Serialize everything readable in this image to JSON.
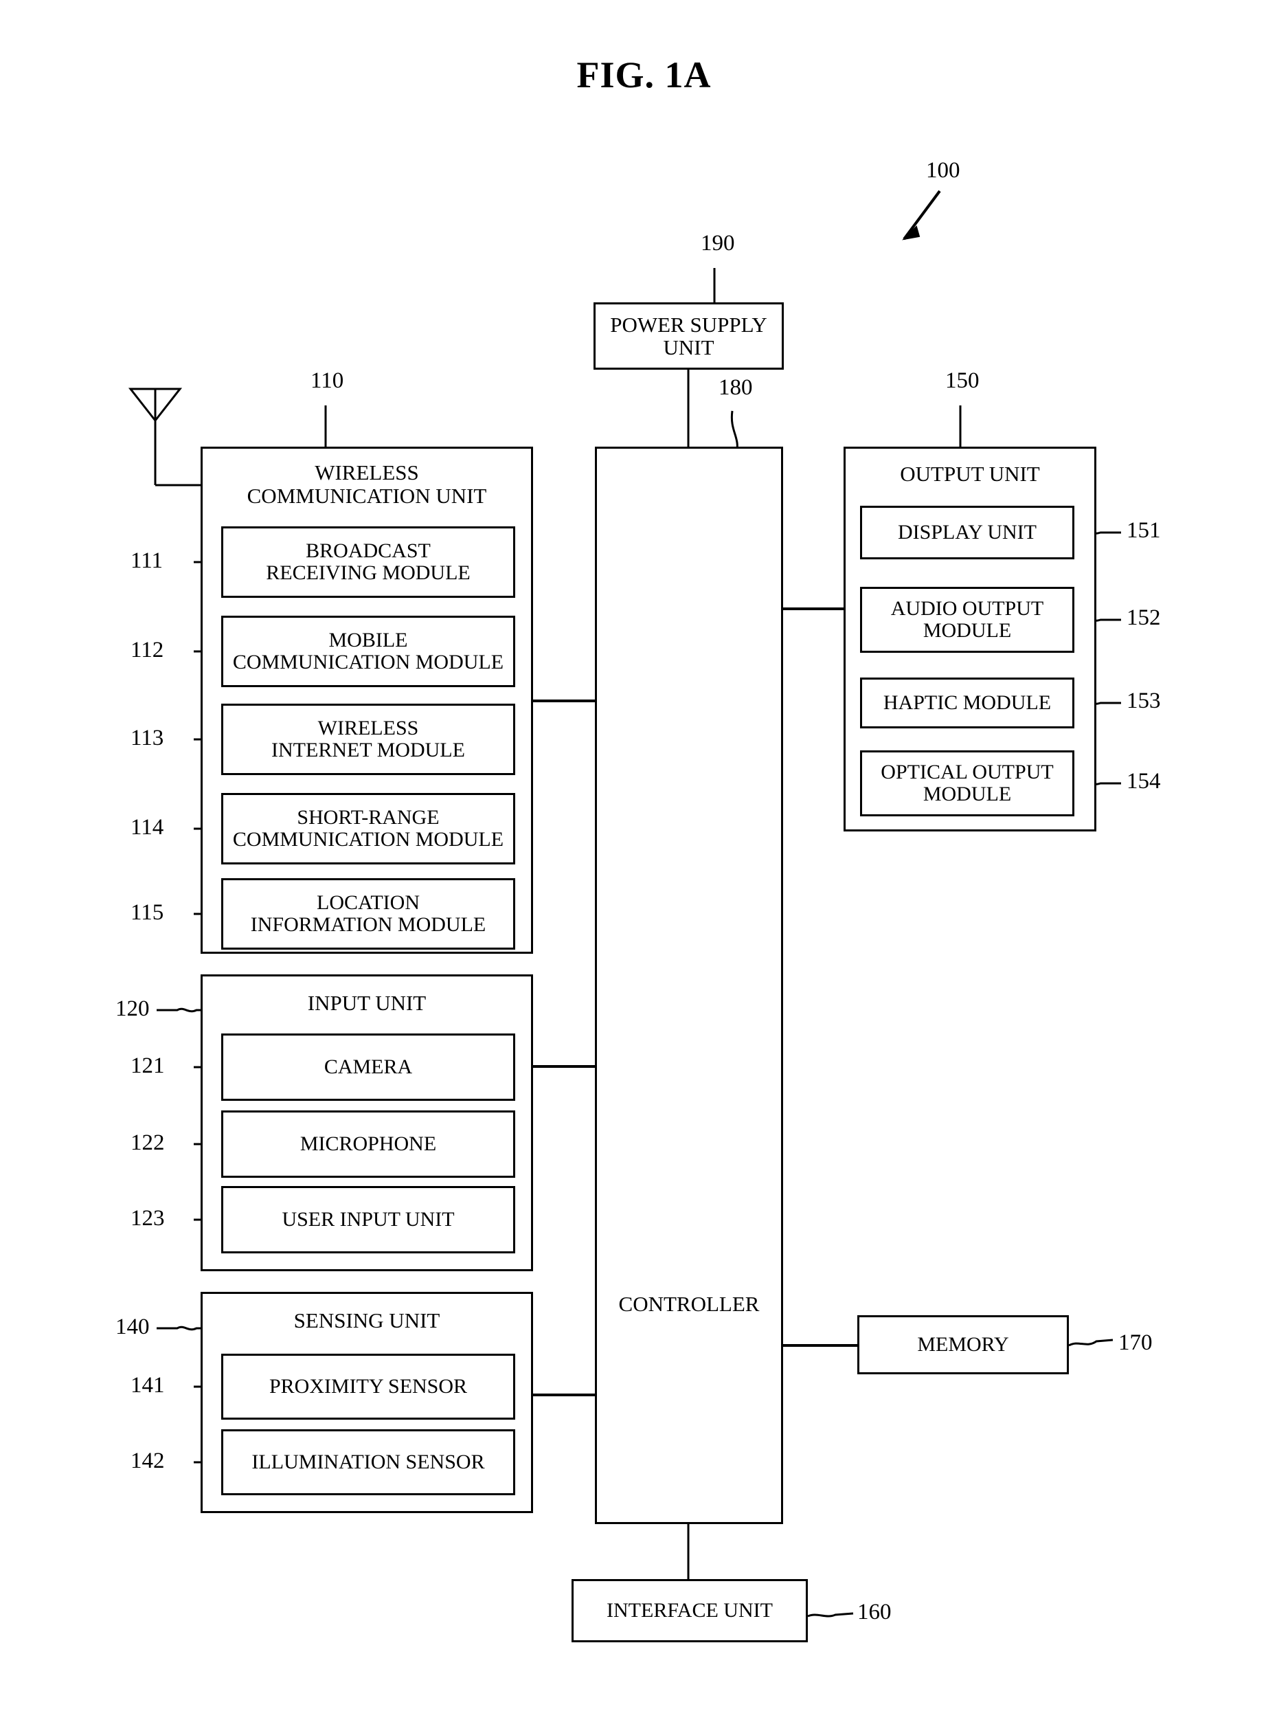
{
  "figure": {
    "title": "FIG. 1A",
    "device_ref": "100"
  },
  "power_supply": {
    "ref": "190",
    "label_line1": "POWER SUPPLY",
    "label_line2": "UNIT"
  },
  "controller": {
    "ref": "180",
    "label": "CONTROLLER"
  },
  "wireless_communication_unit": {
    "ref": "110",
    "title_line1": "WIRELESS",
    "title_line2": "COMMUNICATION UNIT",
    "modules": [
      {
        "ref": "111",
        "line1": "BROADCAST",
        "line2": "RECEIVING MODULE"
      },
      {
        "ref": "112",
        "line1": "MOBILE",
        "line2": "COMMUNICATION MODULE"
      },
      {
        "ref": "113",
        "line1": "WIRELESS",
        "line2": "INTERNET MODULE"
      },
      {
        "ref": "114",
        "line1": "SHORT-RANGE",
        "line2": "COMMUNICATION MODULE"
      },
      {
        "ref": "115",
        "line1": "LOCATION",
        "line2": "INFORMATION MODULE"
      }
    ]
  },
  "input_unit": {
    "ref": "120",
    "title": "INPUT UNIT",
    "modules": [
      {
        "ref": "121",
        "label": "CAMERA"
      },
      {
        "ref": "122",
        "label": "MICROPHONE"
      },
      {
        "ref": "123",
        "label": "USER INPUT UNIT"
      }
    ]
  },
  "sensing_unit": {
    "ref": "140",
    "title": "SENSING UNIT",
    "modules": [
      {
        "ref": "141",
        "label": "PROXIMITY SENSOR"
      },
      {
        "ref": "142",
        "label": "ILLUMINATION SENSOR"
      }
    ]
  },
  "output_unit": {
    "ref": "150",
    "title": "OUTPUT UNIT",
    "modules": [
      {
        "ref": "151",
        "line1": "DISPLAY UNIT",
        "line2": ""
      },
      {
        "ref": "152",
        "line1": "AUDIO OUTPUT",
        "line2": "MODULE"
      },
      {
        "ref": "153",
        "line1": "HAPTIC MODULE",
        "line2": ""
      },
      {
        "ref": "154",
        "line1": "OPTICAL OUTPUT",
        "line2": "MODULE"
      }
    ]
  },
  "memory": {
    "ref": "170",
    "label": "MEMORY"
  },
  "interface_unit": {
    "ref": "160",
    "label": "INTERFACE UNIT"
  },
  "antenna": {
    "name": "antenna-symbol"
  },
  "colors": {
    "line": "#000000",
    "background": "#ffffff"
  }
}
